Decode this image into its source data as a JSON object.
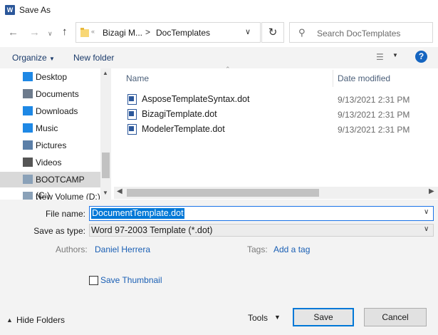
{
  "window": {
    "title": "Save As",
    "app_icon_letter": "W"
  },
  "address": {
    "overflow": "«",
    "crumbs": [
      "Bizagi M...",
      "DocTemplates"
    ],
    "separator": ">"
  },
  "search": {
    "placeholder": "Search DocTemplates"
  },
  "toolbar": {
    "organize": "Organize",
    "new_folder": "New folder",
    "help": "?"
  },
  "nav": {
    "items": [
      {
        "label": "Desktop",
        "icon": "desktop-icon",
        "color": "#1e88e5"
      },
      {
        "label": "Documents",
        "icon": "documents-icon",
        "color": "#6d7b8d"
      },
      {
        "label": "Downloads",
        "icon": "downloads-icon",
        "color": "#1e88e5"
      },
      {
        "label": "Music",
        "icon": "music-icon",
        "color": "#1e88e5"
      },
      {
        "label": "Pictures",
        "icon": "pictures-icon",
        "color": "#5b7fa8"
      },
      {
        "label": "Videos",
        "icon": "videos-icon",
        "color": "#555555"
      },
      {
        "label": "BOOTCAMP (C:)",
        "icon": "drive-icon",
        "color": "#8aa1b8",
        "selected": true
      },
      {
        "label": "New Volume (D:)",
        "icon": "drive-icon",
        "color": "#8aa1b8"
      }
    ]
  },
  "list": {
    "columns": {
      "name": "Name",
      "date": "Date modified"
    },
    "files": [
      {
        "name": "AsposeTemplateSyntax.dot",
        "date": "9/13/2021 2:31 PM"
      },
      {
        "name": "BizagiTemplate.dot",
        "date": "9/13/2021 2:31 PM"
      },
      {
        "name": "ModelerTemplate.dot",
        "date": "9/13/2021 2:31 PM"
      }
    ]
  },
  "form": {
    "file_name_label": "File name:",
    "file_name": "DocumentTemplate.dot",
    "save_type_label": "Save as type:",
    "save_type": "Word 97-2003 Template (*.dot)",
    "authors_label": "Authors:",
    "authors": "Daniel Herrera",
    "tags_label": "Tags:",
    "tags": "Add a tag",
    "save_thumbnail": "Save Thumbnail"
  },
  "footer": {
    "hide_folders": "Hide Folders",
    "tools": "Tools",
    "save": "Save",
    "cancel": "Cancel"
  },
  "colors": {
    "accent": "#0078d7",
    "link": "#1a5fb4",
    "selected_nav": "#d9d9d9"
  }
}
